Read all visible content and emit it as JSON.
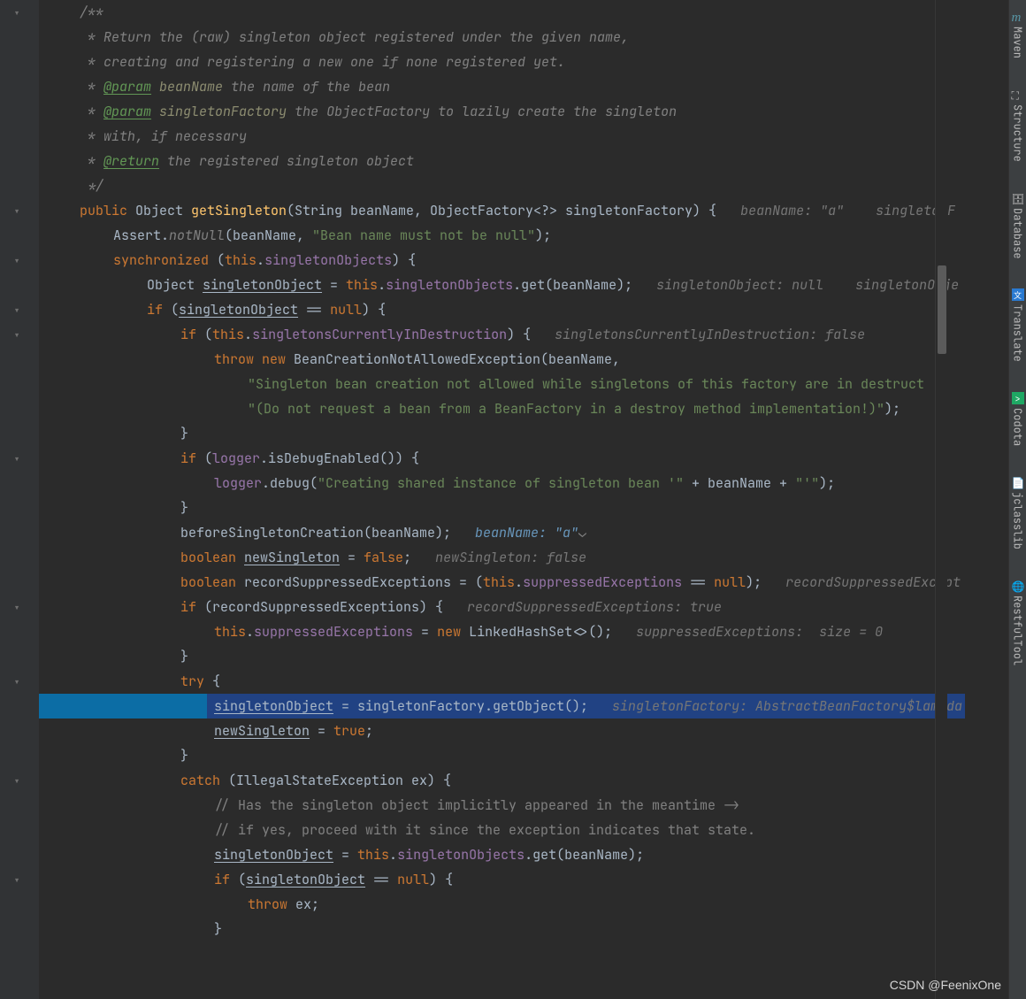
{
  "rightTabs": [
    "Maven",
    "Structure",
    "Database",
    "Translate",
    "Codota",
    "jclasslib",
    "RestfulTool"
  ],
  "watermark": "CSDN @FeenixOne",
  "lines": [
    {
      "i": 1,
      "tokens": [
        {
          "t": "/**",
          "cls": "ci"
        }
      ]
    },
    {
      "i": 2,
      "tokens": [
        {
          "t": " * Return the (raw) singleton object registered under the given name,",
          "cls": "ci"
        }
      ]
    },
    {
      "i": 3,
      "tokens": [
        {
          "t": " * creating and registering a new one if none registered yet.",
          "cls": "ci"
        }
      ]
    },
    {
      "i": 4,
      "tokens": [
        {
          "t": " * ",
          "cls": "ci"
        },
        {
          "t": "@param",
          "cls": "ct u"
        },
        {
          "t": " ",
          "cls": "ci"
        },
        {
          "t": "beanName",
          "cls": "cp"
        },
        {
          "t": " the name of the bean",
          "cls": "ci"
        }
      ]
    },
    {
      "i": 5,
      "tokens": [
        {
          "t": " * ",
          "cls": "ci"
        },
        {
          "t": "@param",
          "cls": "ct u"
        },
        {
          "t": " ",
          "cls": "ci"
        },
        {
          "t": "singletonFactory",
          "cls": "cp"
        },
        {
          "t": " the ObjectFactory to lazily create the singleton",
          "cls": "ci"
        }
      ]
    },
    {
      "i": 6,
      "tokens": [
        {
          "t": " * with, if necessary",
          "cls": "ci"
        }
      ]
    },
    {
      "i": 7,
      "tokens": [
        {
          "t": " * ",
          "cls": "ci"
        },
        {
          "t": "@return",
          "cls": "ct u"
        },
        {
          "t": " the registered singleton object",
          "cls": "ci"
        }
      ]
    },
    {
      "i": 8,
      "tokens": [
        {
          "t": " */",
          "cls": "ci"
        }
      ]
    },
    {
      "i": 9,
      "tokens": [
        {
          "t": "public ",
          "cls": "kw"
        },
        {
          "t": "Object "
        },
        {
          "t": "getSingleton",
          "cls": "mn"
        },
        {
          "t": "(String beanName, ObjectFactory<?> singletonFactory) {   "
        },
        {
          "t": "beanName: \"a\"    singletonF",
          "cls": "hg"
        }
      ]
    },
    {
      "i": 10,
      "tokens": [
        {
          "t": "Assert."
        },
        {
          "t": "notNull",
          "cls": "ci"
        },
        {
          "t": "(beanName, "
        },
        {
          "t": "\"Bean name must not be null\"",
          "cls": "st"
        },
        {
          "t": ");"
        }
      ]
    },
    {
      "i": 11,
      "tokens": [
        {
          "t": "synchronized ",
          "cls": "kw"
        },
        {
          "t": "("
        },
        {
          "t": "this",
          "cls": "kw"
        },
        {
          "t": "."
        },
        {
          "t": "singletonObjects",
          "cls": "v"
        },
        {
          "t": ") {"
        }
      ]
    },
    {
      "i": 12,
      "tokens": [
        {
          "t": "Object "
        },
        {
          "t": "singletonObject",
          "cls": "u"
        },
        {
          "t": " = "
        },
        {
          "t": "this",
          "cls": "kw"
        },
        {
          "t": "."
        },
        {
          "t": "singletonObjects",
          "cls": "v"
        },
        {
          "t": ".get(beanName);   "
        },
        {
          "t": "singletonObject: null    singletonObje",
          "cls": "hg"
        }
      ]
    },
    {
      "i": 13,
      "tokens": [
        {
          "t": "if ",
          "cls": "kw"
        },
        {
          "t": "("
        },
        {
          "t": "singletonObject",
          "cls": "u"
        },
        {
          "t": " == "
        },
        {
          "t": "null",
          "cls": "kw"
        },
        {
          "t": ") {"
        }
      ]
    },
    {
      "i": 14,
      "tokens": [
        {
          "t": "if ",
          "cls": "kw"
        },
        {
          "t": "("
        },
        {
          "t": "this",
          "cls": "kw"
        },
        {
          "t": "."
        },
        {
          "t": "singletonsCurrentlyInDestruction",
          "cls": "v"
        },
        {
          "t": ") {   "
        },
        {
          "t": "singletonsCurrentlyInDestruction: false",
          "cls": "hg"
        }
      ]
    },
    {
      "i": 15,
      "tokens": [
        {
          "t": "throw new ",
          "cls": "kw"
        },
        {
          "t": "BeanCreationNotAllowedException(beanName,"
        }
      ]
    },
    {
      "i": 16,
      "tokens": [
        {
          "t": "\"Singleton bean creation not allowed while singletons of this factory are in destruct",
          "cls": "st"
        }
      ]
    },
    {
      "i": 17,
      "tokens": [
        {
          "t": "\"(Do not request a bean from a BeanFactory in a destroy method implementation!)\"",
          "cls": "st"
        },
        {
          "t": ");"
        }
      ]
    },
    {
      "i": 18,
      "tokens": [
        {
          "t": "}"
        }
      ]
    },
    {
      "i": 19,
      "tokens": [
        {
          "t": "if ",
          "cls": "kw"
        },
        {
          "t": "("
        },
        {
          "t": "logger",
          "cls": "v"
        },
        {
          "t": ".isDebugEnabled()) {"
        }
      ]
    },
    {
      "i": 20,
      "tokens": [
        {
          "t": "logger",
          "cls": "v"
        },
        {
          "t": ".debug("
        },
        {
          "t": "\"Creating shared instance of singleton bean '\"",
          "cls": "st"
        },
        {
          "t": " + beanName + "
        },
        {
          "t": "\"'\"",
          "cls": "st"
        },
        {
          "t": ");"
        }
      ]
    },
    {
      "i": 21,
      "tokens": [
        {
          "t": "}"
        }
      ]
    },
    {
      "i": 22,
      "tokens": [
        {
          "t": "beforeSingletonCreation(beanName);   "
        },
        {
          "t": "beanName: \"a\"",
          "cls": "h"
        },
        {
          "t": "⌄",
          "cls": "c"
        }
      ]
    },
    {
      "i": 23,
      "tokens": [
        {
          "t": "boolean ",
          "cls": "kw"
        },
        {
          "t": "newSingleton",
          "cls": "u"
        },
        {
          "t": " = "
        },
        {
          "t": "false",
          "cls": "kw"
        },
        {
          "t": ";   "
        },
        {
          "t": "newSingleton: false",
          "cls": "hg"
        }
      ]
    },
    {
      "i": 24,
      "tokens": [
        {
          "t": "boolean ",
          "cls": "kw"
        },
        {
          "t": "recordSuppressedExceptions = ("
        },
        {
          "t": "this",
          "cls": "kw"
        },
        {
          "t": "."
        },
        {
          "t": "suppressedExceptions",
          "cls": "v"
        },
        {
          "t": " == "
        },
        {
          "t": "null",
          "cls": "kw"
        },
        {
          "t": ");   "
        },
        {
          "t": "recordSuppressedExcept",
          "cls": "hg"
        }
      ]
    },
    {
      "i": 25,
      "tokens": [
        {
          "t": "if ",
          "cls": "kw"
        },
        {
          "t": "(recordSuppressedExceptions) {   "
        },
        {
          "t": "recordSuppressedExceptions: true",
          "cls": "hg"
        }
      ]
    },
    {
      "i": 26,
      "tokens": [
        {
          "t": "this",
          "cls": "kw"
        },
        {
          "t": "."
        },
        {
          "t": "suppressedExceptions",
          "cls": "v"
        },
        {
          "t": " = "
        },
        {
          "t": "new ",
          "cls": "kw"
        },
        {
          "t": "LinkedHashSet<>();   "
        },
        {
          "t": "suppressedExceptions:  size = 0",
          "cls": "hg"
        }
      ]
    },
    {
      "i": 27,
      "tokens": [
        {
          "t": "}"
        }
      ]
    },
    {
      "i": 28,
      "tokens": [
        {
          "t": "try ",
          "cls": "kw"
        },
        {
          "t": "{"
        }
      ]
    },
    {
      "i": 29,
      "hl": true,
      "depth": 5,
      "tokens": [
        {
          "t": "singletonObject",
          "cls": "u"
        },
        {
          "t": " = singletonFactory.getObject();   "
        },
        {
          "t": "singletonFactory: AbstractBeanFactory$lambda",
          "cls": "hg"
        }
      ]
    },
    {
      "i": 30,
      "tokens": [
        {
          "t": "newSingleton",
          "cls": "u"
        },
        {
          "t": " = "
        },
        {
          "t": "true",
          "cls": "kw"
        },
        {
          "t": ";"
        }
      ]
    },
    {
      "i": 31,
      "tokens": [
        {
          "t": "}"
        }
      ]
    },
    {
      "i": 32,
      "tokens": [
        {
          "t": "catch ",
          "cls": "kw"
        },
        {
          "t": "(IllegalStateException ex) {"
        }
      ]
    },
    {
      "i": 33,
      "tokens": [
        {
          "t": "// Has the singleton object implicitly appeared in the meantime ->",
          "cls": "c"
        }
      ]
    },
    {
      "i": 34,
      "tokens": [
        {
          "t": "// if yes, proceed with it since the exception indicates that state.",
          "cls": "c"
        }
      ]
    },
    {
      "i": 35,
      "tokens": [
        {
          "t": "singletonObject",
          "cls": "u"
        },
        {
          "t": " = "
        },
        {
          "t": "this",
          "cls": "kw"
        },
        {
          "t": "."
        },
        {
          "t": "singletonObjects",
          "cls": "v"
        },
        {
          "t": ".get(beanName);"
        }
      ]
    },
    {
      "i": 36,
      "tokens": [
        {
          "t": "if ",
          "cls": "kw"
        },
        {
          "t": "("
        },
        {
          "t": "singletonObject",
          "cls": "u"
        },
        {
          "t": " == "
        },
        {
          "t": "null",
          "cls": "kw"
        },
        {
          "t": ") {"
        }
      ]
    },
    {
      "i": 37,
      "tokens": [
        {
          "t": "throw ",
          "cls": "kw"
        },
        {
          "t": "ex;"
        }
      ]
    },
    {
      "i": 38,
      "tokens": [
        {
          "t": "}"
        }
      ]
    }
  ],
  "indent": [
    1,
    1,
    1,
    1,
    1,
    1,
    1,
    1,
    1,
    2,
    2,
    3,
    3,
    4,
    5,
    6,
    6,
    4,
    4,
    5,
    4,
    4,
    4,
    4,
    4,
    5,
    4,
    4,
    5,
    5,
    4,
    4,
    5,
    5,
    5,
    5,
    6,
    5
  ]
}
